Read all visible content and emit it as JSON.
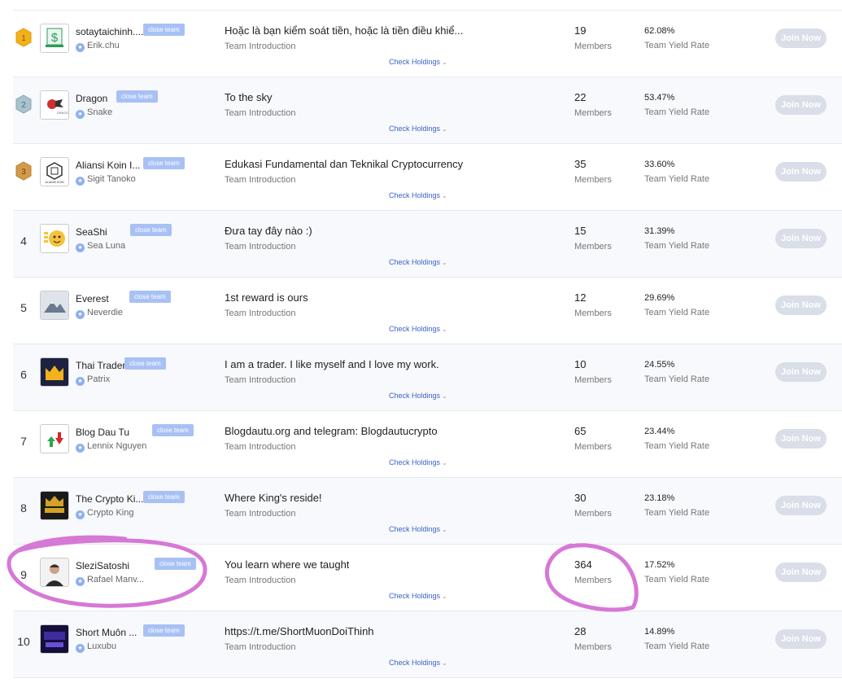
{
  "ui": {
    "close_team": "close team",
    "team_intro": "Team Introduction",
    "check_holdings": "Check Holdings",
    "members": "Members",
    "yield_rate": "Team Yield Rate",
    "join": "Join Now",
    "annotation_color": "#d678d6",
    "badge_color": "#a8c1f5",
    "link_color": "#3a62c4"
  },
  "teams": [
    {
      "rank": "1",
      "name": "sotaytaichinh....",
      "leader": "Erik.chu",
      "description": "Hoặc là bạn kiểm soát tiền, hoặc là tiền điều khiể...",
      "members": "19",
      "yield": "62.08%",
      "medal": "gold-medal-icon"
    },
    {
      "rank": "2",
      "name": "Dragon",
      "leader": "Snake",
      "description": "To the sky",
      "members": "22",
      "yield": "53.47%",
      "medal": "silver-medal-icon"
    },
    {
      "rank": "3",
      "name": "Aliansi Koin I...",
      "leader": "Sigit Tanoko",
      "description": "Edukasi Fundamental dan Teknikal Cryptocurrency",
      "members": "35",
      "yield": "33.60%",
      "medal": "bronze-medal-icon"
    },
    {
      "rank": "4",
      "name": "SeaShi",
      "leader": "Sea Luna",
      "description": "Đưa tay đây nào :)",
      "members": "15",
      "yield": "31.39%"
    },
    {
      "rank": "5",
      "name": "Everest",
      "leader": "Neverdie",
      "description": "1st reward is ours",
      "members": "12",
      "yield": "29.69%"
    },
    {
      "rank": "6",
      "name": "Thai Trader",
      "leader": "Patrix",
      "description": "I am a trader. I like myself and I love my work.",
      "members": "10",
      "yield": "24.55%"
    },
    {
      "rank": "7",
      "name": "Blog Dau Tu",
      "leader": "Lennix Nguyen",
      "description": "Blogdautu.org and telegram: Blogdautucrypto",
      "members": "65",
      "yield": "23.44%"
    },
    {
      "rank": "8",
      "name": "The Crypto Ki...",
      "leader": "Crypto King",
      "description": "Where King's reside!",
      "members": "30",
      "yield": "23.18%"
    },
    {
      "rank": "9",
      "name": "SleziSatoshi",
      "leader": "Rafael Manv...",
      "description": "You learn where we taught",
      "members": "364",
      "yield": "17.52%"
    },
    {
      "rank": "10",
      "name": "Short Muôn ...",
      "leader": "Luxubu",
      "description": "https://t.me/ShortMuonDoiThinh",
      "members": "28",
      "yield": "14.89%"
    }
  ]
}
